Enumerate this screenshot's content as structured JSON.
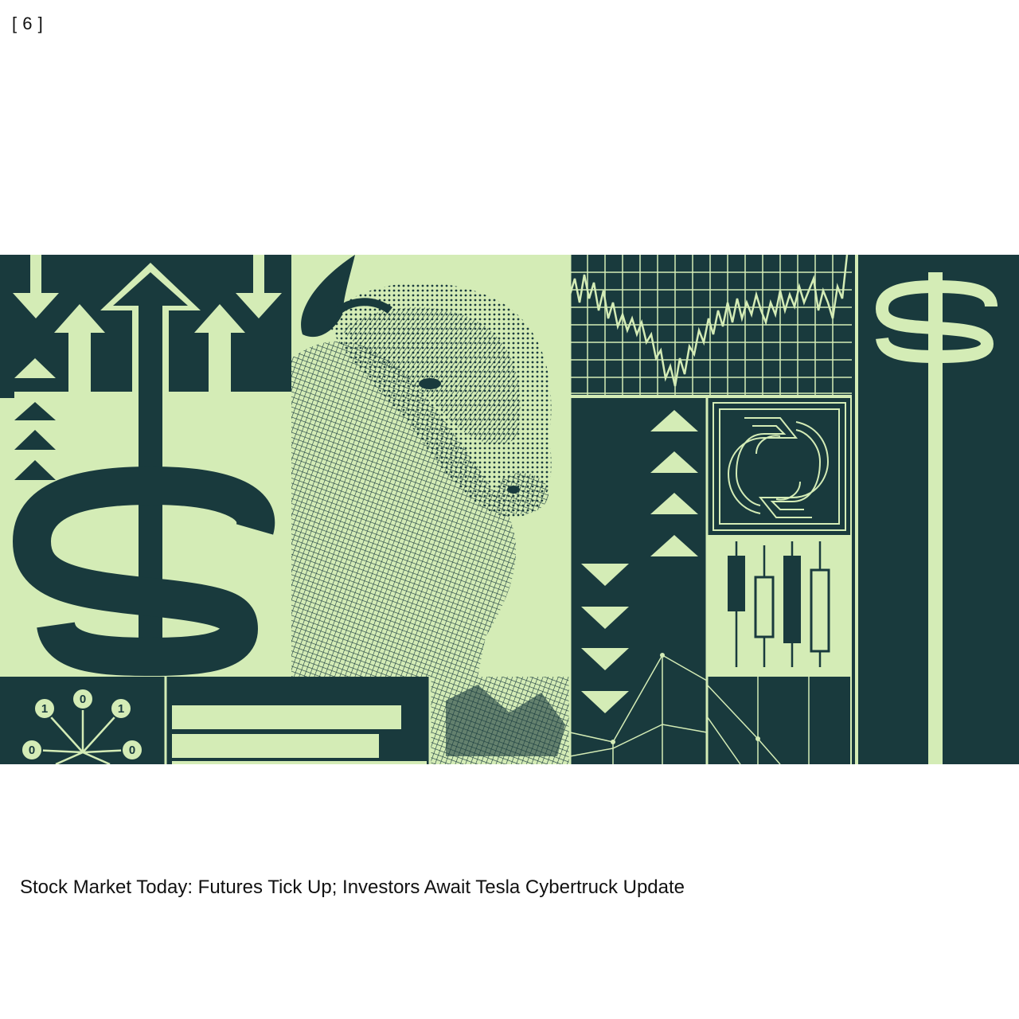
{
  "item": {
    "index_label": "[ 6 ]",
    "headline": "Stock Market Today: Futures Tick Up; Investors Await Tesla Cybertruck Update"
  },
  "image": {
    "palette": {
      "dark": "#193a3d",
      "light": "#d4ecb6"
    },
    "icons": [
      "dollar-sign-icon",
      "bull-engraving",
      "up-arrow-icon",
      "down-arrow-icon",
      "candlestick-icon",
      "line-chart-icon",
      "bar-chart-icon",
      "network-node-icon",
      "rotation-arrows-icon"
    ],
    "node_labels": [
      "1",
      "0",
      "1",
      "0",
      "0"
    ]
  }
}
